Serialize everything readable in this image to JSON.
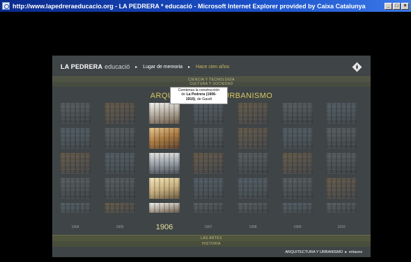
{
  "window": {
    "title": "http://www.lapedreraeducacio.org - LA PEDRERA * educació - Microsoft Internet Explorer provided by Caixa Catalunya",
    "buttons": [
      "_",
      "□",
      "×"
    ]
  },
  "header": {
    "brand": "LA PEDRERA",
    "brand_sub": "educació",
    "breadcrumb": [
      "Lugar de memoria",
      "Hace cien años"
    ],
    "compass_icon": "compass-icon"
  },
  "bands": {
    "top": [
      "CIENCIA Y TECNOLOGÍA",
      "CULTURA Y SOCIEDAD"
    ],
    "bottom": [
      "LAS ARTES",
      "HISTORIA"
    ]
  },
  "section_title": "ARQUITECTURA Y URBANISMO",
  "tooltip": {
    "line1": "Comienza la construcción",
    "line2_prefix": "de ",
    "line2_bold": "La Pedrera (1906-",
    "line3_bold": "1910)",
    "line3_suffix": ", de Gaudí"
  },
  "years": [
    "1904",
    "1905",
    "1906",
    "1907",
    "1908",
    "1909",
    "1910"
  ],
  "selected_year": "1906",
  "footer": {
    "section": "ARQUITECTURA Y URBANISMO",
    "link": "enlaces"
  },
  "colors": {
    "panel": "#3f4446",
    "accent": "#d8c860",
    "titlebar": "#1a4fc8"
  }
}
